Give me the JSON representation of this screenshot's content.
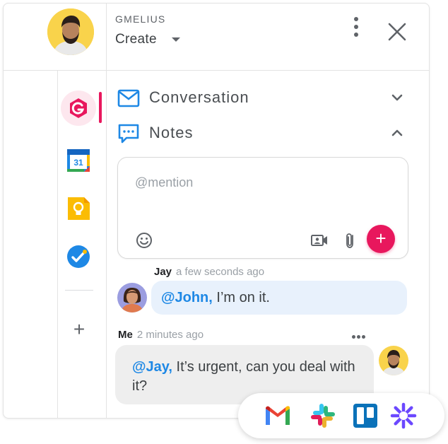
{
  "header": {
    "brand": "GMELIUS",
    "create_label": "Create"
  },
  "sections": [
    {
      "title": "Conversation",
      "expanded": false
    },
    {
      "title": "Notes",
      "expanded": true
    }
  ],
  "composer": {
    "placeholder": "@mention",
    "value": ""
  },
  "calendar_day": "31",
  "rail": {
    "icons": [
      "gmelius-icon",
      "google-calendar-icon",
      "google-keep-icon",
      "google-tasks-icon"
    ],
    "active": "gmelius-icon"
  },
  "messages": [
    {
      "author": "Jay",
      "time": "a few seconds ago",
      "mention": "@John,",
      "text": " I’m on it."
    },
    {
      "author": "Me",
      "time": "2 minutes ago",
      "mention": "@Jay,",
      "text": " It’s urgent, can you deal with it?"
    }
  ],
  "integrations": [
    "gmail-icon",
    "slack-icon",
    "trello-icon",
    "zapier-icon"
  ],
  "colors": {
    "accent": "#e8175d",
    "mention": "#1e88e5",
    "bubble_incoming": "#e8f1fc",
    "bubble_outgoing": "#eeeeee",
    "section_icon": "#1e88e5"
  }
}
